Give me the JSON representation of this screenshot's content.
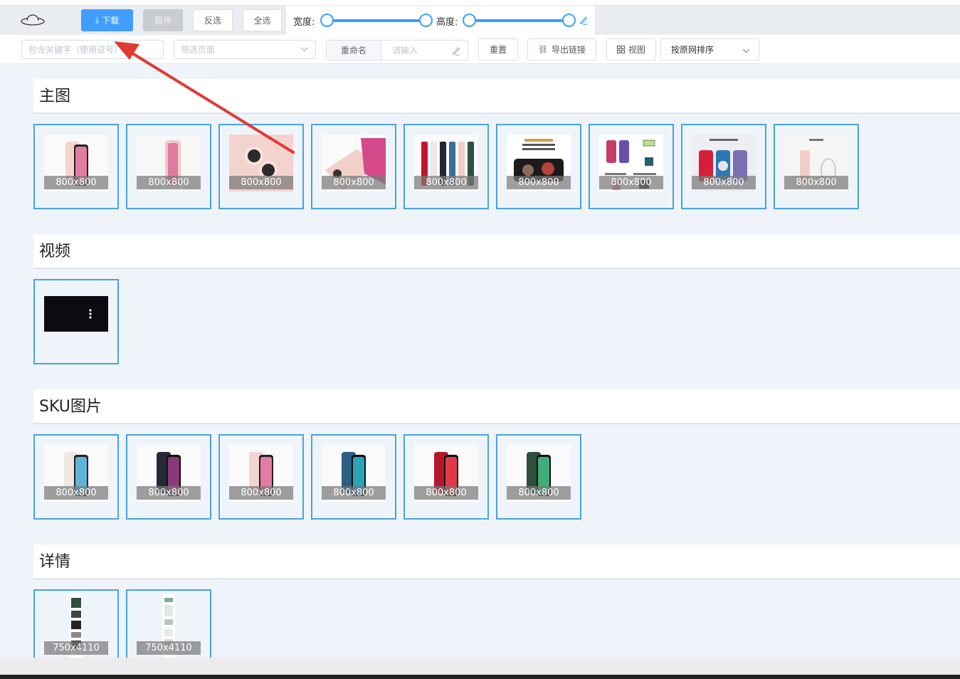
{
  "toolbar": {
    "download_label": "下载",
    "pause_label": "暂停",
    "invert_label": "反选",
    "select_all_label": "全选",
    "width_label": "宽度:",
    "height_label": "高度:"
  },
  "filters": {
    "keyword_placeholder": "包含关键字（使用逗号）",
    "page_filter_placeholder": "筛选页面",
    "rename_label": "重命名",
    "rename_placeholder": "请输入",
    "reset_label": "重置",
    "export_links_label": "导出链接",
    "view_label": "视图",
    "sort_value": "按原网排序"
  },
  "sections": [
    {
      "title": "主图",
      "items": [
        "800x800",
        "800x800",
        "800x800",
        "800x800",
        "800x800",
        "800x800",
        "800x800",
        "800x800",
        "800x800"
      ]
    },
    {
      "title": "视频",
      "items": [
        ""
      ]
    },
    {
      "title": "SKU图片",
      "items": [
        "800x800",
        "800x800",
        "800x800",
        "800x800",
        "800x800",
        "800x800"
      ]
    },
    {
      "title": "详情",
      "items": [
        "750x4110",
        "750x4110"
      ]
    }
  ],
  "colors": {
    "accent": "#409eff",
    "tile_border": "#4aa3dd",
    "annotation_arrow": "#e03a33"
  }
}
